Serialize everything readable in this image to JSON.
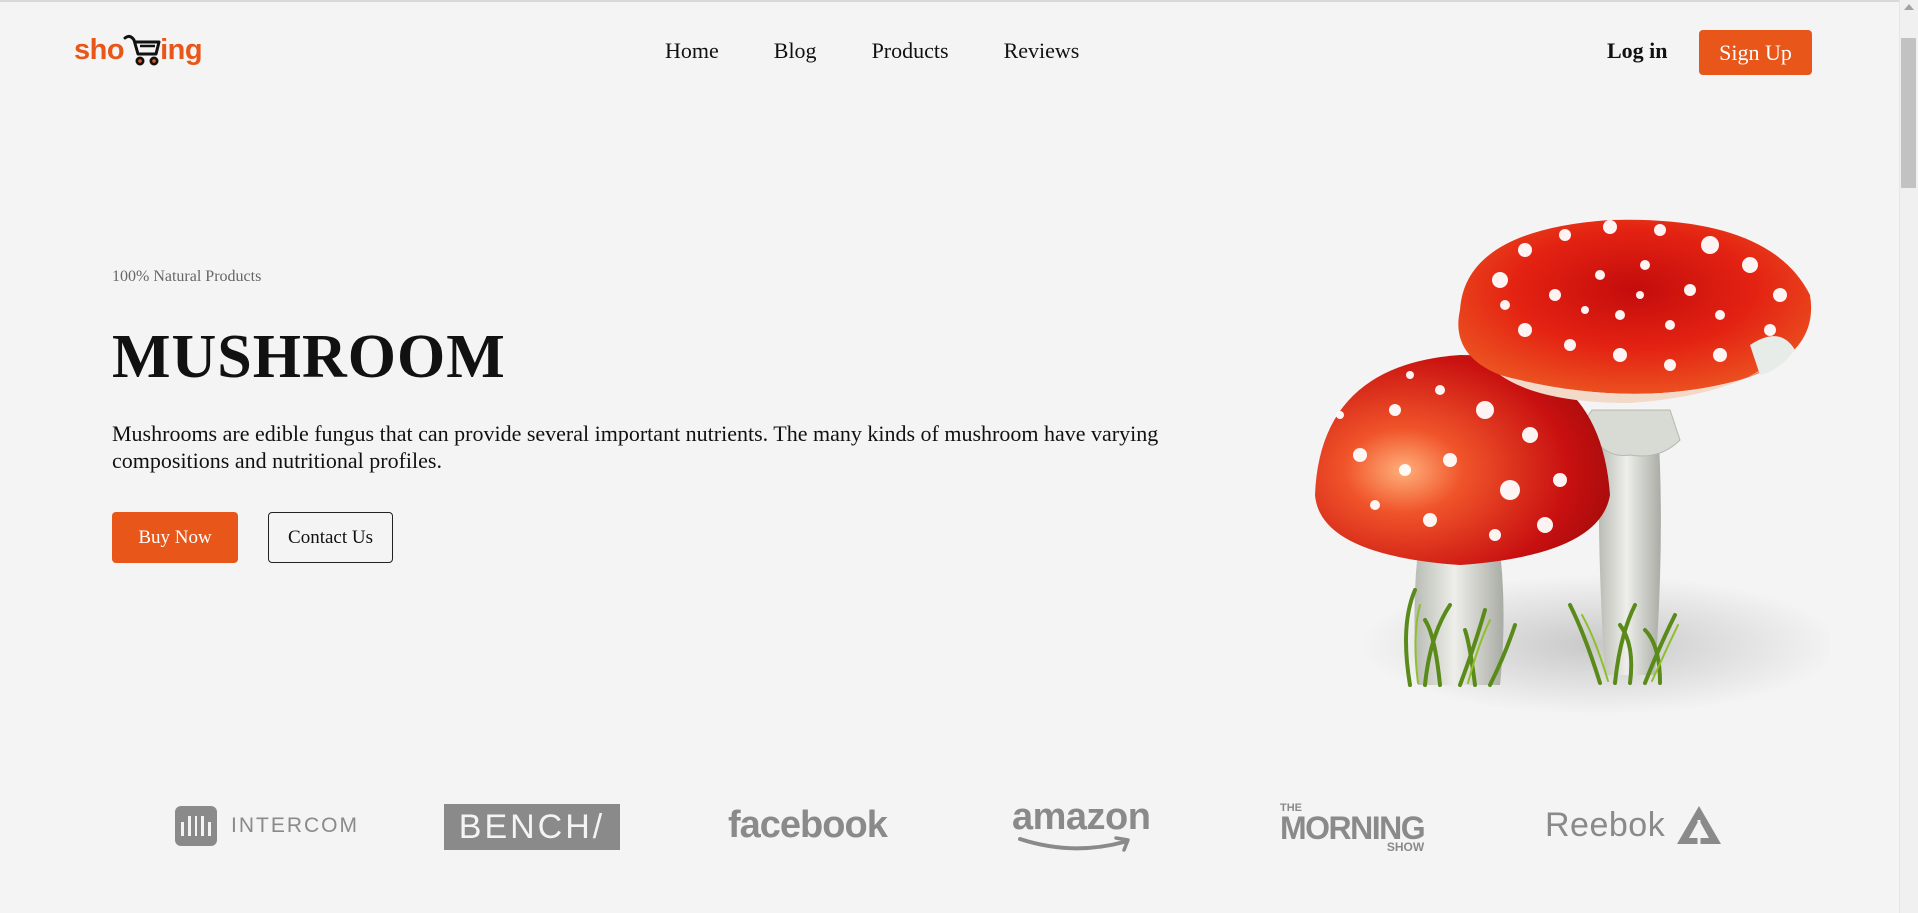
{
  "header": {
    "logo_text_left": "sho",
    "logo_text_right": "ing",
    "nav": [
      {
        "label": "Home"
      },
      {
        "label": "Blog"
      },
      {
        "label": "Products"
      },
      {
        "label": "Reviews"
      }
    ],
    "login_label": "Log in",
    "signup_label": "Sign Up"
  },
  "hero": {
    "eyebrow": "100% Natural Products",
    "title": "MUSHROOM",
    "description": "Mushrooms are edible fungus that can provide several important nutrients. The many kinds of mushroom have varying compositions and nutritional profiles.",
    "buy_label": "Buy Now",
    "contact_label": "Contact Us"
  },
  "brands": {
    "intercom": "INTERCOM",
    "bench": "BENCH/",
    "facebook": "facebook",
    "amazon": "amazon",
    "morning_the": "THE",
    "morning_main": "MORNING",
    "morning_show": "SHOW",
    "reebok": "Reebok"
  },
  "colors": {
    "accent": "#e8561a",
    "background": "#f4f4f4",
    "brand_gray": "#8a8a8a"
  },
  "icons": {
    "logo_cart": "shopping-cart-icon",
    "reebok_mark": "reebok-delta-icon",
    "amazon_smile": "amazon-smile-icon"
  }
}
